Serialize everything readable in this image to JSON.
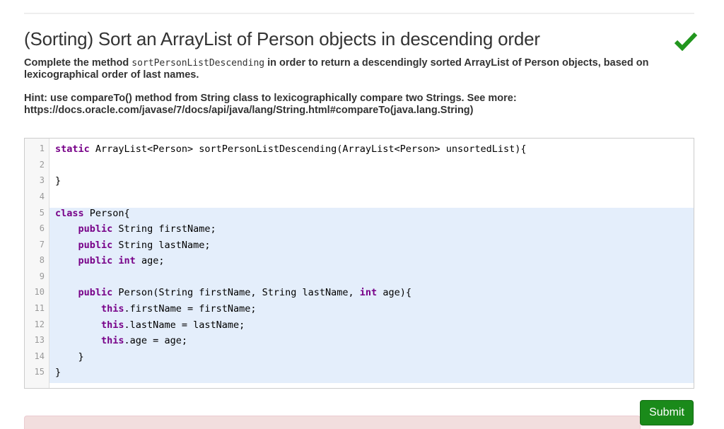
{
  "header": {
    "title": "(Sorting) Sort an ArrayList of Person objects in descending order",
    "status_icon": "check-icon",
    "status_color": "#22961e"
  },
  "description": {
    "prefix": "Complete the method ",
    "method_name": "sortPersonListDescending",
    "suffix": " in order to return a descendingly sorted ArrayList of Person objects, based on lexicographical order of last names."
  },
  "hint": {
    "line1": "Hint: use compareTo() method from String class to lexicographically compare two Strings. See more:",
    "line2": "https://docs.oracle.com/javase/7/docs/api/java/lang/String.html#compareTo(java.lang.String)"
  },
  "editor": {
    "line_numbers": [
      "1",
      "2",
      "3",
      "4",
      "5",
      "6",
      "7",
      "8",
      "9",
      "10",
      "11",
      "12",
      "13",
      "14",
      "15"
    ],
    "lines": [
      {
        "kw": "static",
        "rest": " ArrayList<Person> sortPersonListDescending(ArrayList<Person> unsortedList){"
      },
      {
        "rest": ""
      },
      {
        "rest": "}"
      },
      {
        "rest": ""
      },
      {
        "kw": "class",
        "rest": " Person{"
      },
      {
        "indent": "    ",
        "kw": "public",
        "rest": " String firstName;"
      },
      {
        "indent": "    ",
        "kw": "public",
        "rest": " String lastName;"
      },
      {
        "indent": "    ",
        "kw": "public",
        "kw2": " int",
        "rest": " age;"
      },
      {
        "rest": ""
      },
      {
        "indent": "    ",
        "kw": "public",
        "rest": " Person(String firstName, String lastName, ",
        "kw3": "int",
        "rest2": " age){"
      },
      {
        "indent": "        ",
        "kw": "this",
        "rest": ".firstName = firstName;"
      },
      {
        "indent": "        ",
        "kw": "this",
        "rest": ".lastName = lastName;"
      },
      {
        "indent": "        ",
        "kw": "this",
        "rest": ".age = age;"
      },
      {
        "indent": "    ",
        "rest": "}"
      },
      {
        "rest": "}"
      }
    ]
  },
  "actions": {
    "submit_label": "Submit",
    "submit_color": "#1a8a1a"
  }
}
